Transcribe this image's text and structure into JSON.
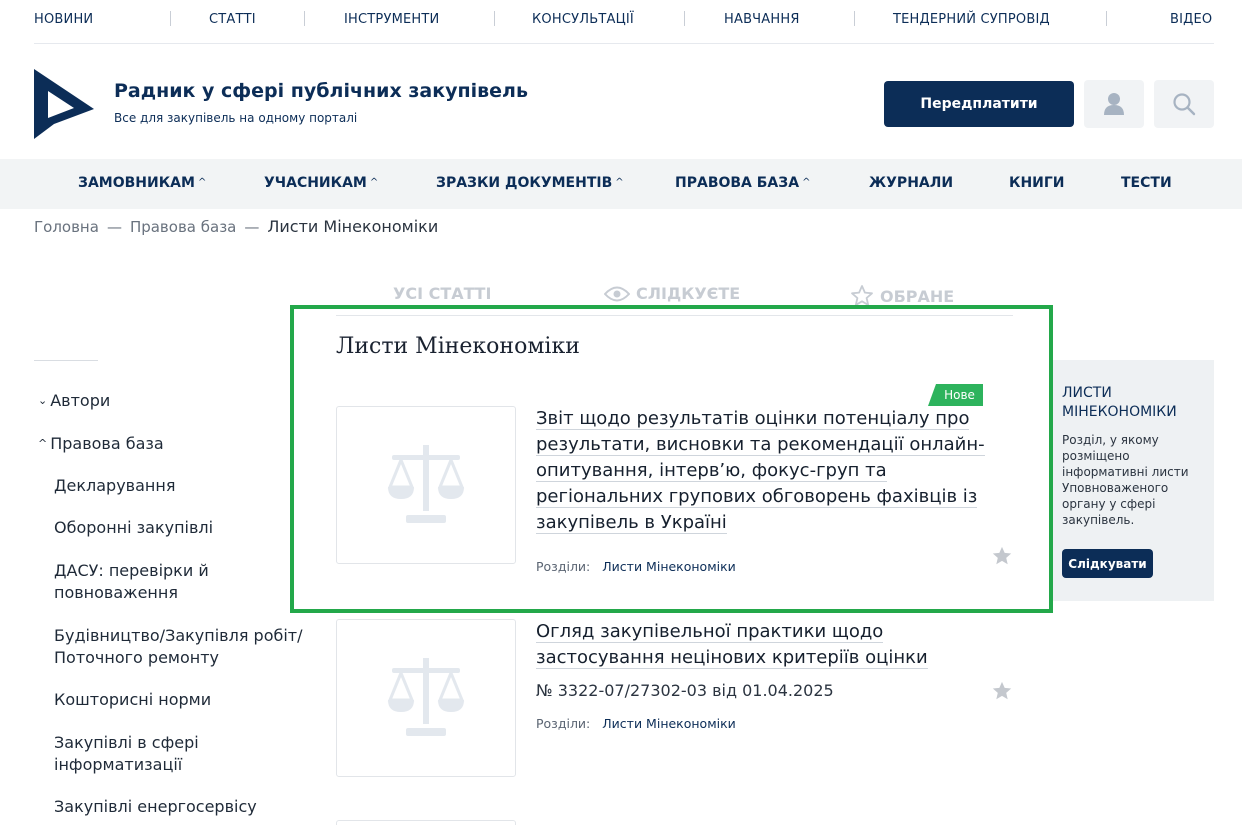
{
  "topnav": {
    "items": [
      "НОВИНИ",
      "СТАТТІ",
      "ІНСТРУМЕНТИ",
      "КОНСУЛЬТАЦІЇ",
      "НАВЧАННЯ",
      "ТЕНДЕРНИЙ СУПРОВІД",
      "ВІДЕО"
    ]
  },
  "header": {
    "title": "Радник у сфері публічних закупівель",
    "subtitle": "Все для закупівель на одному порталі",
    "subscribe_label": "Передплатити",
    "user_icon": "user-icon",
    "search_icon": "search-icon"
  },
  "mainmenu": {
    "items": [
      "ЗАМОВНИКАМ",
      "УЧАСНИКАМ",
      "ЗРАЗКИ ДОКУМЕНТІВ",
      "ПРАВОВА БАЗА",
      "ЖУРНАЛИ",
      "КНИГИ",
      "ТЕСТИ"
    ],
    "caret": "^"
  },
  "breadcrumb": {
    "home": "Головна",
    "parent": "Правова база",
    "current": "Листи Мінекономіки",
    "separator": "—"
  },
  "tabs": {
    "all": "УСІ СТАТТІ",
    "following": "СЛІДКУЄТЕ",
    "favorites": "ОБРАНЕ"
  },
  "sidebar": {
    "authors": "Автори",
    "legal_base": "Правова база",
    "subitems": [
      "Декларування",
      "Оборонні закупівлі",
      "ДАСУ: перевірки й повноваження",
      "Будівництво/Закупівля робіт/ Поточного ремонту",
      "Кошторисні норми",
      "Закупівлі в сфері інформатизації",
      "Закупівлі енергосервісу"
    ]
  },
  "section": {
    "title": "Листи Мінекономіки"
  },
  "articles": [
    {
      "title": "Звіт щодо результатів оцінки потенціалу про результати, висновки та рекомендації онлайн-опитування, інтерв’ю, фокус-груп та регіональних групових обговорень фахівців із закупівель в Україні",
      "badge": "Нове",
      "sections_label": "Розділи:",
      "section_link": "Листи Мінекономіки"
    },
    {
      "title": "Огляд закупівельної практики щодо застосування нецінових критеріїв оцінки",
      "number": "№ 3322-07/27302-03 від 01.04.2025",
      "sections_label": "Розділи:",
      "section_link": "Листи Мінекономіки"
    }
  ],
  "infobox": {
    "title": "ЛИСТИ МІНЕКОНОМІКИ",
    "text": "Розділ, у якому розміщено інформативні листи Уповноваженого органу у сфері закупівель.",
    "follow_label": "Слідкувати"
  },
  "colors": {
    "brand": "#0c2d57",
    "highlight": "#23a84a",
    "badge": "#2db35d"
  }
}
